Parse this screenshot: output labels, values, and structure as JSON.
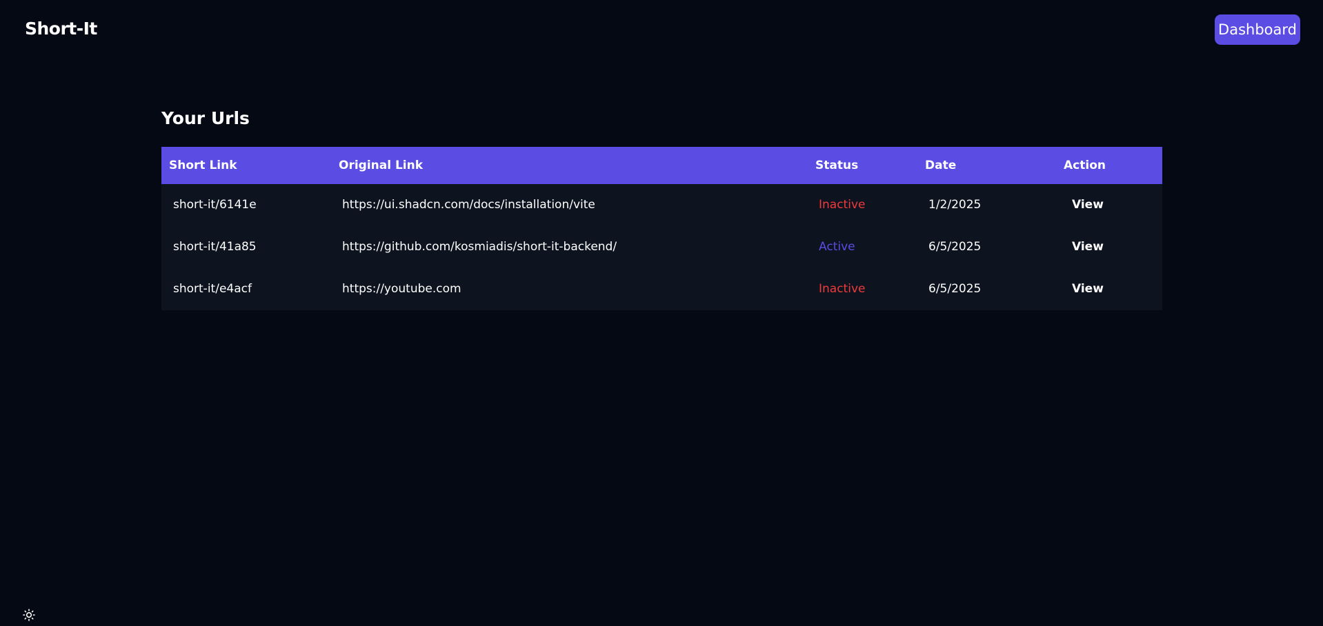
{
  "header": {
    "brand": "Short-It",
    "dashboard_label": "Dashboard"
  },
  "main": {
    "title": "Your Urls",
    "columns": [
      "Short Link",
      "Original Link",
      "Status",
      "Date",
      "Action"
    ],
    "rows": [
      {
        "short": "short-it/6141e",
        "original": "https://ui.shadcn.com/docs/installation/vite",
        "status": "Inactive",
        "date": "1/2/2025",
        "action": "View"
      },
      {
        "short": "short-it/41a85",
        "original": "https://github.com/kosmiadis/short-it-backend/",
        "status": "Active",
        "date": "6/5/2025",
        "action": "View"
      },
      {
        "short": "short-it/e4acf",
        "original": "https://youtube.com",
        "status": "Inactive",
        "date": "6/5/2025",
        "action": "View"
      }
    ]
  },
  "footer": {
    "theme_icon": "sun-icon"
  },
  "colors": {
    "background": "#050914",
    "accent": "#5b4de3",
    "table_body": "#0e1320",
    "inactive": "#ef3b3b",
    "active": "#5b4de3"
  }
}
